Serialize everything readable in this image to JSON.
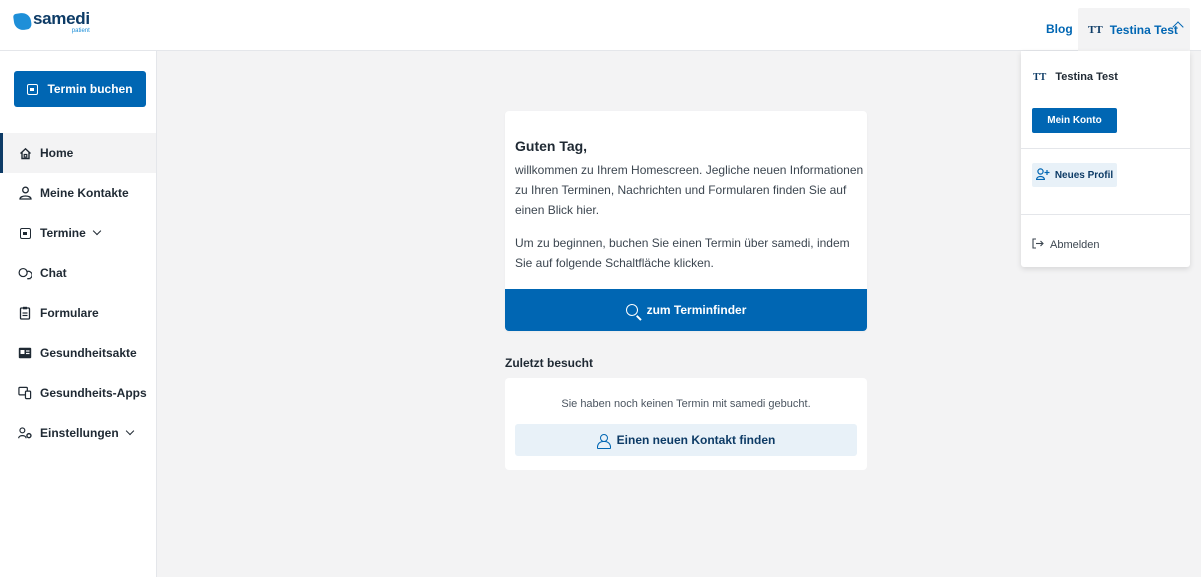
{
  "header": {
    "logo_word": "samedi",
    "logo_sub": "patient",
    "blog_label": "Blog",
    "user_initials": "TT",
    "user_name": "Testina Test"
  },
  "sidebar": {
    "book_button": "Termin buchen",
    "items": [
      {
        "label": "Home",
        "icon": "home-icon",
        "active": true
      },
      {
        "label": "Meine Kontakte",
        "icon": "contacts-icon"
      },
      {
        "label": "Termine",
        "icon": "calendar-icon",
        "expandable": true
      },
      {
        "label": "Chat",
        "icon": "chat-icon"
      },
      {
        "label": "Formulare",
        "icon": "form-icon"
      },
      {
        "label": "Gesundheitsakte",
        "icon": "health-record-icon"
      },
      {
        "label": "Gesundheits-Apps",
        "icon": "apps-icon"
      },
      {
        "label": "Einstellungen",
        "icon": "settings-icon",
        "expandable": true
      }
    ]
  },
  "welcome": {
    "title": "Guten Tag,",
    "paragraph1": "willkommen zu Ihrem Homescreen. Jegliche neuen Informationen zu Ihren Terminen, Nachrichten und Formularen finden Sie auf einen Blick hier.",
    "paragraph2": "Um zu beginnen, buchen Sie einen Termin über samedi, indem Sie auf folgende Schaltfläche klicken.",
    "finder_button": "zum Terminfinder"
  },
  "recent": {
    "title": "Zuletzt besucht",
    "empty_text": "Sie haben noch keinen Termin mit samedi gebucht.",
    "contact_button": "Einen neuen Kontakt finden"
  },
  "dropdown": {
    "user_initials": "TT",
    "user_name": "Testina Test",
    "account_button": "Mein Konto",
    "new_profile_button": "Neues Profil",
    "logout_label": "Abmelden"
  },
  "colors": {
    "primary": "#0066b3",
    "dark_blue": "#0d3b66",
    "light_blue": "#e8f1f8",
    "background": "#f3f3f4"
  }
}
